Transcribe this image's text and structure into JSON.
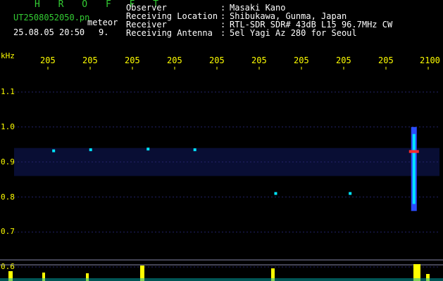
{
  "header": {
    "brand": "H R O F F T",
    "filename": "UT2508052050.pn",
    "meteor_label": "meteor",
    "datetime": "25.08.05 20:50",
    "count": "9."
  },
  "info": [
    {
      "label": "Observer",
      "value": "Masaki Kano"
    },
    {
      "label": "Receiving Location",
      "value": "Shibukawa, Gunma, Japan"
    },
    {
      "label": "Receiver",
      "value": "RTL-SDR SDR# 43dB L15 96.7MHz CW"
    },
    {
      "label": "Receiving Antenna",
      "value": "5el Yagi Az 280 for Seoul"
    }
  ],
  "info_colon": ":",
  "chart_data": {
    "type": "heatmap",
    "ylabel": "kHz",
    "y_ticks": [
      "1.1",
      "1.0",
      "0.9",
      "0.8",
      "0.7",
      "0.6"
    ],
    "x_ticks": [
      "205",
      "205",
      "205",
      "205",
      "205",
      "205",
      "205",
      "205",
      "205",
      "2100"
    ],
    "ylim": [
      0.6,
      1.1
    ],
    "grid": true,
    "echoes": [
      {
        "time_frac": 0.093,
        "freq": 0.932
      },
      {
        "time_frac": 0.18,
        "freq": 0.935
      },
      {
        "time_frac": 0.315,
        "freq": 0.937
      },
      {
        "time_frac": 0.425,
        "freq": 0.935
      },
      {
        "time_frac": 0.615,
        "freq": 0.81
      },
      {
        "time_frac": 0.79,
        "freq": 0.81
      },
      {
        "time_frac": 0.94,
        "freq": 0.93
      }
    ],
    "main_echo": {
      "time_frac": 0.94,
      "freq_top": 1.0,
      "freq_bottom": 0.76,
      "freq_peak": 0.93
    }
  },
  "colors": {
    "background": "#000000",
    "label_text": "#ffffff",
    "brand": "#33cc33",
    "ticks": "#ffff00",
    "noise_band": "#0a0f3a",
    "grid": "#23236a",
    "echo_core": "#ff2a2a",
    "echo_mid": "#00e5ff",
    "echo_low": "#2a4dff"
  }
}
